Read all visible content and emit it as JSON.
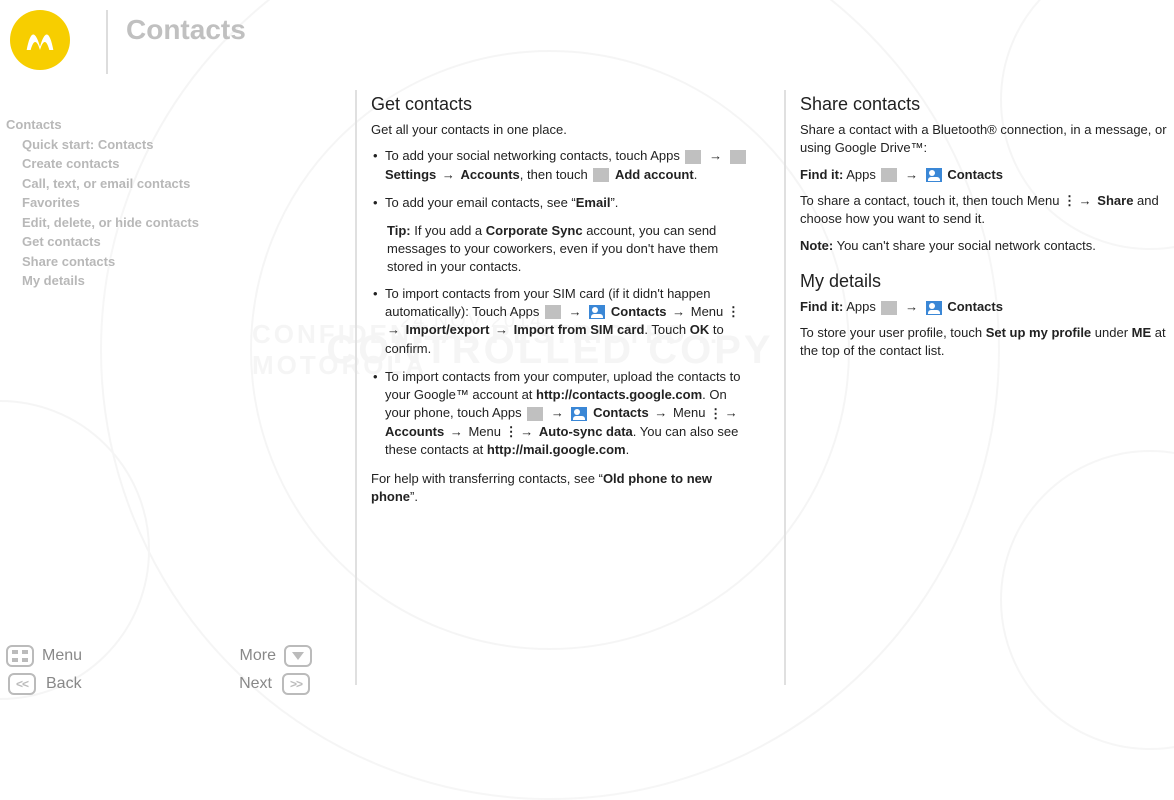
{
  "page_title": "Contacts",
  "sidebar": {
    "heading": "Contacts",
    "items": [
      "Quick start: Contacts",
      "Create contacts",
      "Call, text, or email contacts",
      "Favorites",
      "Edit, delete, or hide contacts",
      "Get contacts",
      "Share contacts",
      "My details"
    ]
  },
  "left_col": {
    "h2": "Get contacts",
    "intro": "Get all your contacts in one place.",
    "b1_a": "To add your social networking contacts, touch Apps ",
    "b1_settings": " Settings",
    "b1_accounts": "Accounts",
    "b1_then": ", then touch ",
    "b1_add": " Add account",
    "b2_a": "To add your email contacts, see “",
    "b2_email": "Email",
    "b2_b": "”.",
    "tip_label": "Tip:",
    "tip_a": " If you add a ",
    "tip_corp": "Corporate Sync",
    "tip_b": " account, you can send messages to your coworkers, even if you don't have them stored in your contacts.",
    "b3_a": "To import contacts from your SIM card (if it didn't happen automatically): Touch Apps ",
    "b3_contacts": " Contacts",
    "b3_menu": " Menu ",
    "b3_ie": "Import/export",
    "b3_import": "Import from SIM card",
    "b3_touch": ". Touch ",
    "b3_ok": "OK",
    "b3_confirm": " to confirm.",
    "b4_a": "To import contacts from your computer, upload the contacts to your Google™ account at ",
    "b4_url1": "http://contacts.google.com",
    "b4_b": ". On your phone, touch Apps ",
    "b4_contacts": " Contacts",
    "b4_menu": " Menu ",
    "b4_accounts": "Accounts",
    "b4_menu2": " Menu ",
    "b4_auto": "Auto-sync data",
    "b4_c": ". You can also see these contacts at ",
    "b4_url2": "http://mail.google.com",
    "outro_a": "For help with transferring contacts, see “",
    "outro_b": "Old phone to new phone",
    "outro_c": "”."
  },
  "right_col": {
    "share_h2": "Share contacts",
    "share_p1": "Share a contact with a Bluetooth® connection, in a message, or using Google Drive™:",
    "find_label": "Find it:",
    "find_apps": " Apps ",
    "find_contacts": " Contacts",
    "share_p2a": "To share a contact, touch it, then touch Menu ",
    "share_p2_share": "Share",
    "share_p2b": " and choose how you want to send it.",
    "note_label": "Note:",
    "note_text": " You can't share your social network contacts.",
    "details_h2": "My details",
    "details_find_label": "Find it:",
    "details_apps": " Apps ",
    "details_contacts": " Contacts",
    "details_p_a": "To store your user profile, touch ",
    "details_setup": "Set up my profile",
    "details_under": " under ",
    "details_me": "ME",
    "details_p_b": " at the top of the contact list."
  },
  "nav": {
    "menu": "Menu",
    "more": "More",
    "back": "Back",
    "next": "Next"
  }
}
